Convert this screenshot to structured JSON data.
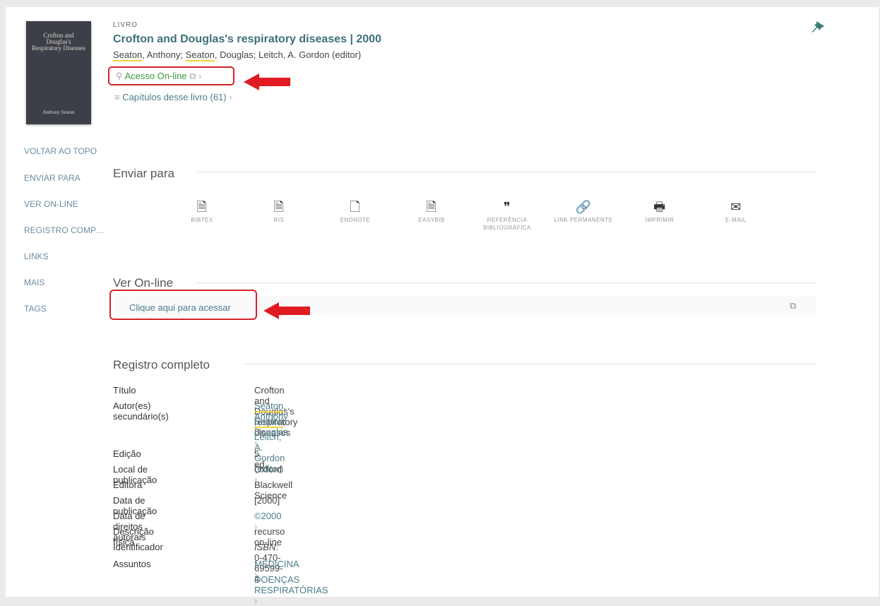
{
  "cover": {
    "title": "Crofton and Douglas's Respiratory Diseases",
    "author": "Anthony Seaton"
  },
  "record": {
    "type": "LIVRO",
    "title": "Crofton and Douglas's respiratory diseases | 2000",
    "authors": {
      "a1": "Seaton",
      "a1rest": ", Anthony; ",
      "a2": "Seaton",
      "a2rest": ", Douglas; Leitch, A. Gordon (editor)"
    }
  },
  "links": {
    "online_access": "Acesso On-line",
    "chapters": "Capítulos desse livro (61)"
  },
  "nav": [
    "VOLTAR AO TOPO",
    "ENVIAR PARA",
    "VER ON-LINE",
    "REGISTRO COMP…",
    "LINKS",
    "MAIS",
    "TAGS"
  ],
  "send": {
    "title": "Enviar para",
    "items": [
      {
        "icon": "bibtex-icon",
        "glyph": "🗎",
        "label": "BIBTEX"
      },
      {
        "icon": "ris-icon",
        "glyph": "🗎",
        "label": "RIS"
      },
      {
        "icon": "endnote-icon",
        "glyph": "🗋",
        "label": "ENDNOTE"
      },
      {
        "icon": "easybib-icon",
        "glyph": "🗎",
        "label": "EASYBIB"
      },
      {
        "icon": "quote-icon",
        "glyph": "❞",
        "label": "REFERÊNCIA BIBLIOGRÁFICA"
      },
      {
        "icon": "link-icon",
        "glyph": "🔗",
        "label": "LINK PERMANENTE"
      },
      {
        "icon": "print-icon",
        "glyph": "🖶",
        "label": "IMPRIMIR"
      },
      {
        "icon": "mail-icon",
        "glyph": "✉",
        "label": "E-MAIL"
      }
    ]
  },
  "online": {
    "title": "Ver On-line",
    "link": "Clique aqui para acessar"
  },
  "full_record": {
    "title": "Registro completo",
    "fields": {
      "titulo_label": "Título",
      "titulo": "Crofton and Douglas's respiratory diseases",
      "autores_label": "Autor(es) secundário(s)",
      "autor1": "Seaton",
      "autor1rest": ", Anthony",
      "autor2": "Seaton",
      "autor2rest": ", Douglas",
      "autor3": "Leitch, A. Gordon (editor)",
      "edicao_label": "Edição",
      "edicao": "5. ed.",
      "local_label": "Local de publicação",
      "local": "Oxford",
      "editora_label": "Editora",
      "editora": "Blackwell Science",
      "data_label": "Data de publicação",
      "data": "[2000]",
      "direitos_label": "Data de direitos autorais",
      "direitos": "©2000",
      "descricao_label": "Descrição física",
      "descricao": "recurso on-line",
      "ident_label": "Identificador",
      "ident_key": "ISBN",
      "ident_val": ": 0-470-69599-4",
      "assuntos_label": "Assuntos",
      "assunto1": "MEDICINA",
      "assunto2": "DOENÇAS RESPIRATÓRIAS"
    }
  },
  "colors": {
    "accent": "#3d6f7a",
    "link": "#4a7c8a",
    "highlight_box": "#d3212b",
    "online_green": "#3a9a3a"
  }
}
